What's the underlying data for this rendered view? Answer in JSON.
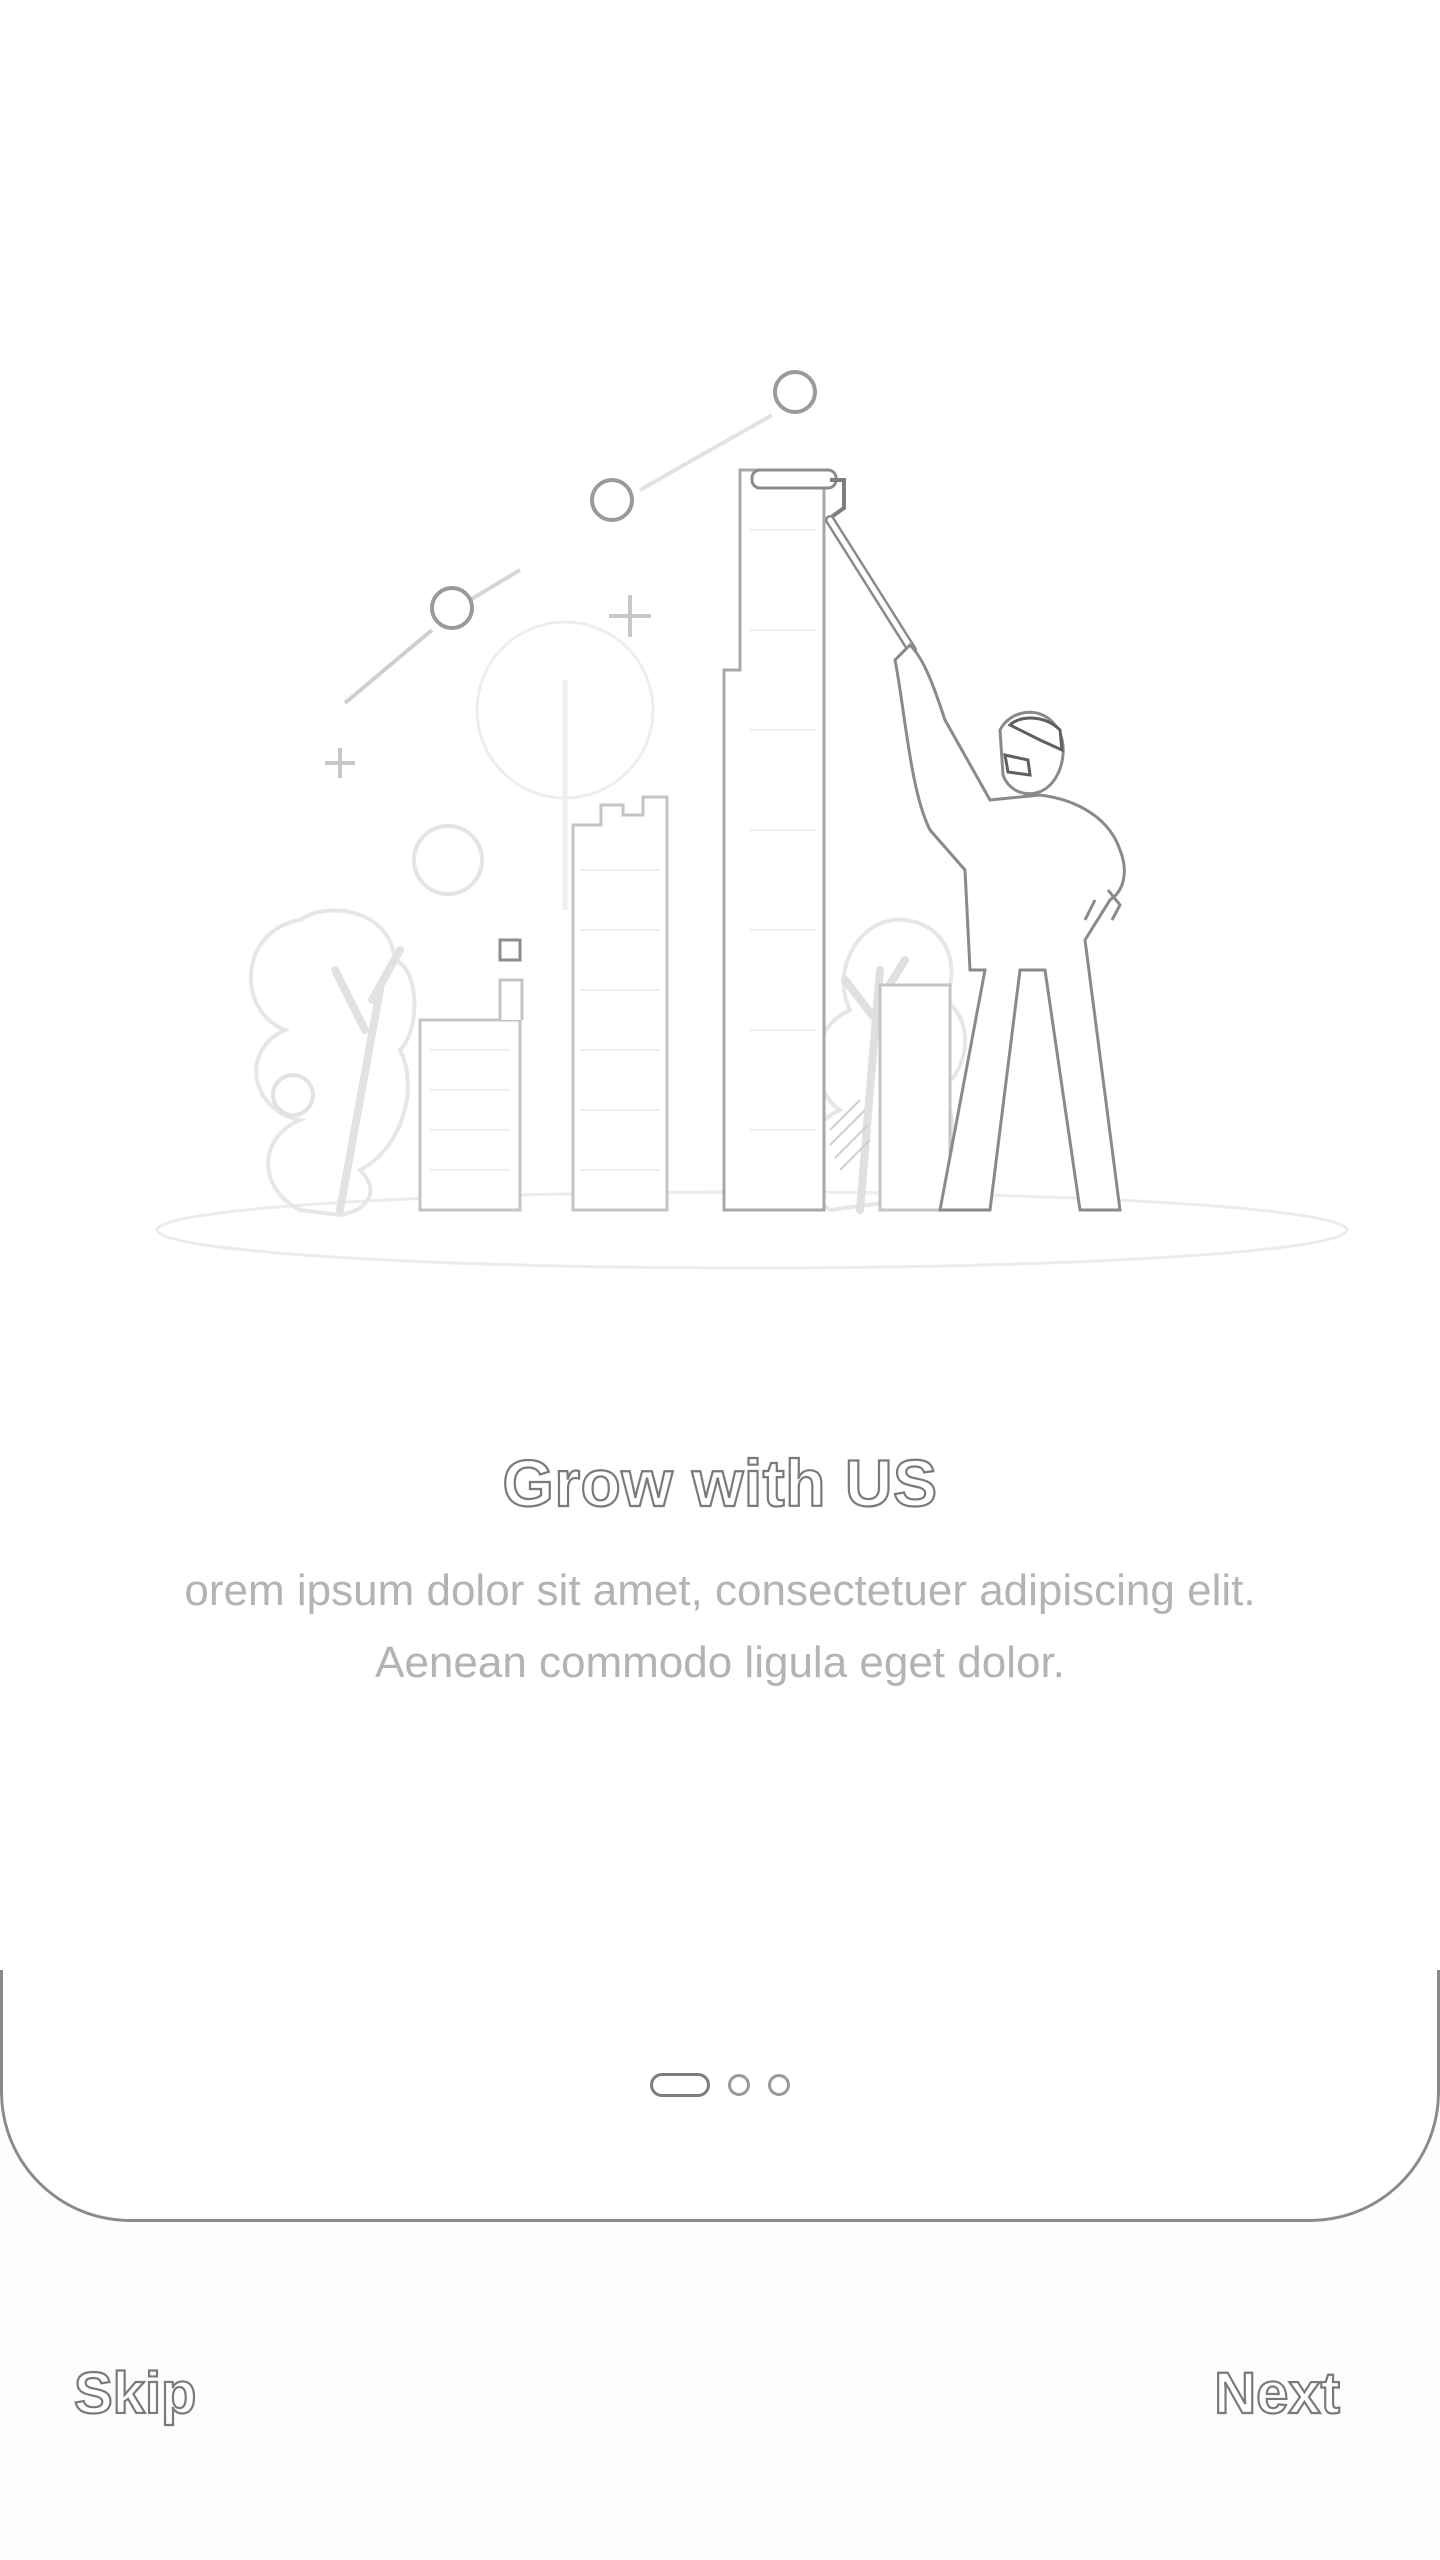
{
  "onboarding": {
    "title": "Grow with US",
    "description": "orem ipsum dolor sit amet, consectetuer adipiscing elit. Aenean commodo ligula eget dolor.",
    "illustration_icon": "growth-chart-illustration",
    "pager": {
      "total_pages": 3,
      "current_page": 1
    }
  },
  "footer": {
    "skip_label": "Skip",
    "next_label": "Next"
  },
  "colors": {
    "background": "#ffffff",
    "outline": "#7a7a7a",
    "text_muted": "#b3b3b3"
  }
}
